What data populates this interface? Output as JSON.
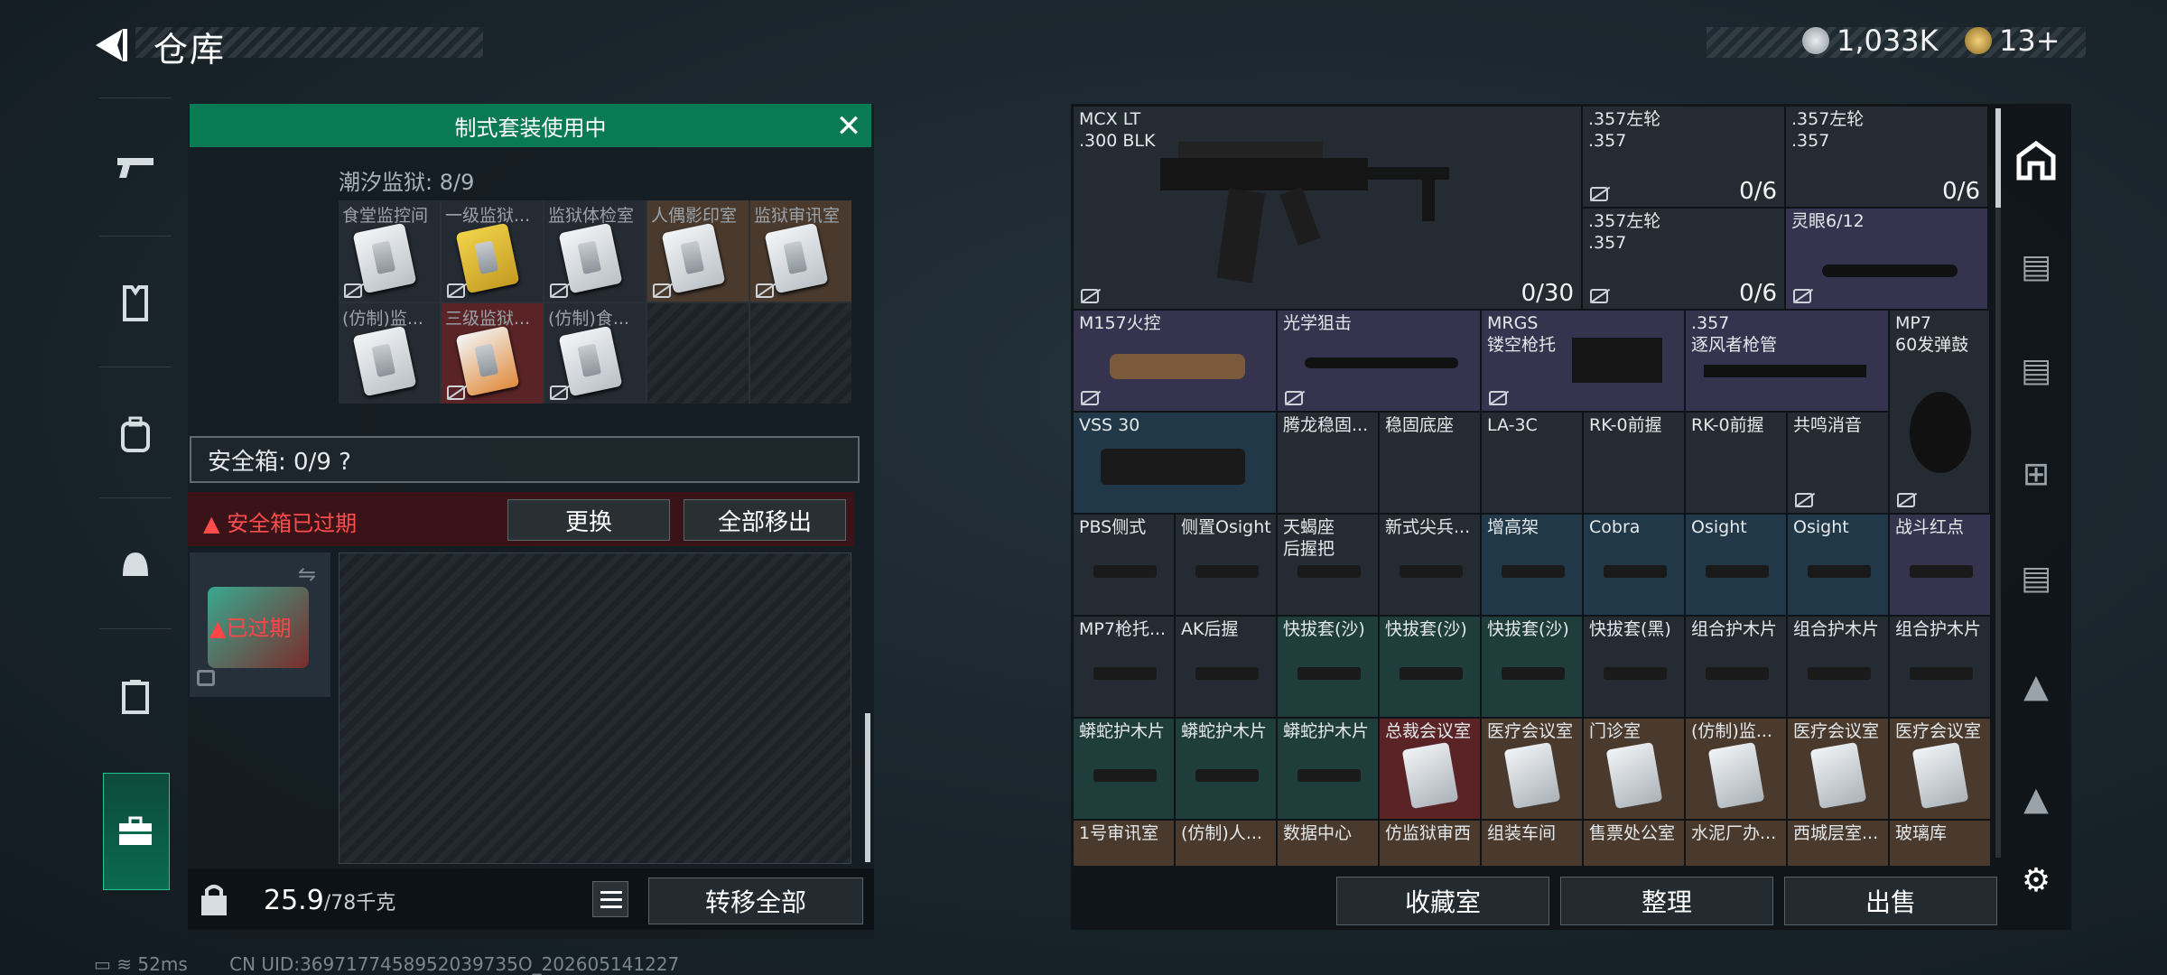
{
  "header": {
    "title": "仓库",
    "currency_1": "1,033K",
    "currency_2": "13+",
    "colors": {
      "accent": "#0a7a55",
      "danger": "#ff4c4c"
    }
  },
  "left_nav": [
    "gun-icon",
    "vest-icon",
    "backpack-icon",
    "helmet-icon",
    "container-icon",
    "briefcase-icon"
  ],
  "set_banner": {
    "label": "制式套装使用中"
  },
  "tide_prison": {
    "label": "潮汐监狱: 8/9",
    "cells": [
      "食堂监控间",
      "一级监狱...",
      "监狱体检室",
      "人偶影印室",
      "监狱审讯室",
      "(仿制)监...",
      "三级监狱...",
      "(仿制)食..."
    ]
  },
  "safebox": {
    "label": "安全箱: 0/9 ?",
    "expired_warning": "安全箱已过期",
    "replace_button": "更换",
    "remove_all_button": "全部移出",
    "expired_tag": "已过期"
  },
  "footer_left": {
    "weight": "25.9",
    "weight_unit": "/78千克",
    "transfer_all_button": "转移全部"
  },
  "inventory": {
    "rifle": {
      "name": "MCX LT\n.300 BLK",
      "count": "0/30"
    },
    "rev1": {
      "name": ".357左轮\n.357",
      "count": "0/6"
    },
    "rev2": {
      "name": ".357左轮\n.357",
      "count": "0/6"
    },
    "rev3": {
      "name": ".357左轮\n.357",
      "count": "0/6"
    },
    "scope_lm": {
      "name": "灵眼6/12"
    },
    "row3": [
      "M157火控",
      "光学狙击",
      "MRGS\n镂空枪托",
      ".357\n逐风者枪管",
      "MP7\n60发弹鼓"
    ],
    "row4": [
      "VSS 30",
      "腾龙稳固...",
      "稳固底座",
      "LA-3C",
      "RK-0前握",
      "RK-0前握",
      "共鸣消音"
    ],
    "row5": [
      "PBS侧式",
      "侧置Osight",
      "天蝎座\n后握把",
      "新式尖兵...",
      "增高架",
      "Cobra",
      "Osight",
      "Osight",
      "战斗红点"
    ],
    "row6": [
      "MP7枪托...",
      "AK后握",
      "快拔套(沙)",
      "快拔套(沙)",
      "快拔套(沙)",
      "快拔套(黑)",
      "组合护木片",
      "组合护木片",
      "组合护木片"
    ],
    "row7": [
      "蟒蛇护木片",
      "蟒蛇护木片",
      "蟒蛇护木片",
      "总裁会议室",
      "医疗会议室",
      "门诊室",
      "(仿制)监...",
      "医疗会议室",
      "医疗会议室"
    ],
    "row8": [
      "1号审讯室",
      "(仿制)人...",
      "数据中心",
      "仿监狱审西",
      "组装车间",
      "售票处公室",
      "水泥厂办...",
      "西城层室...",
      "玻璃库"
    ]
  },
  "bottom_buttons": {
    "collection": "收藏室",
    "organize": "整理",
    "sell": "出售"
  },
  "status_bar": {
    "ping": "52ms",
    "uid": "CN UID:3697177458952039735O_202605141227"
  }
}
